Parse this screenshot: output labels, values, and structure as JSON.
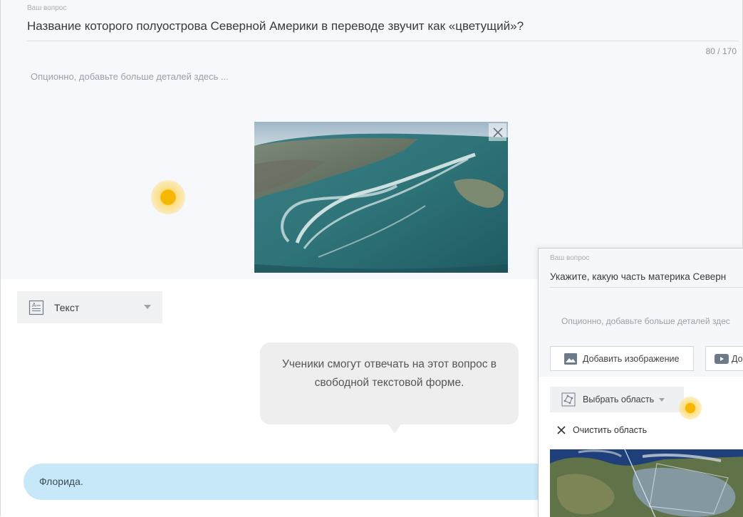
{
  "question": {
    "label": "Ваш вопрос",
    "title": "Название которого полуострова Северной Америки в переводе звучит как «цветущий»?",
    "counter": "80 / 170",
    "details_placeholder": "Опционно, добавьте больше деталей здесь ..."
  },
  "answer_type": {
    "icon": "text-doc-icon",
    "selected": "Текст"
  },
  "tooltip": {
    "text": "Ученики смогут отвечать на этот вопрос в свободной текстовой форме."
  },
  "answer": {
    "value": "Флорида."
  },
  "panel": {
    "label": "Ваш вопрос",
    "title": "Укажите, какую часть материка Северн",
    "details_placeholder": "Опционно, добавьте больше деталей здес",
    "add_image_label": "Добавить изображение",
    "add_video_label": "До",
    "select_area_label": "Выбрать область",
    "clear_area_label": "Очистить область"
  },
  "colors": {
    "card_bg": "#f7f8fc",
    "answer_bg": "#c7e8f8",
    "tooltip_bg": "#eeeeee",
    "cursor": "#f5b700"
  }
}
